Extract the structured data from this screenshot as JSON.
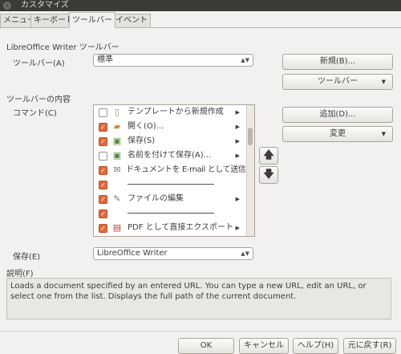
{
  "window": {
    "title": "カスタマイズ",
    "close_glyph": "x"
  },
  "tabs": [
    {
      "label": "メニュー"
    },
    {
      "label": "キーボード"
    },
    {
      "label": "ツールバー"
    },
    {
      "label": "イベント"
    }
  ],
  "toolbar_section": {
    "heading": "LibreOffice Writer ツールバー",
    "toolbar_label": "ツールバー(A)",
    "toolbar_value": "標準",
    "new_button": "新規(B)...",
    "toolbar_menu_button": "ツールバー"
  },
  "content_section": {
    "heading": "ツールバーの内容",
    "command_label": "コマンド(C)",
    "add_button": "追加(D)...",
    "modify_button": "変更",
    "commands": [
      {
        "label": "テンプレートから新規作成",
        "checked": false,
        "icon": "template-icon",
        "glyph": "▯",
        "submenu": true
      },
      {
        "label": "開く(O)...",
        "checked": true,
        "icon": "folder-icon",
        "glyph": "📁",
        "submenu": true
      },
      {
        "label": "保存(S)",
        "checked": true,
        "icon": "save-icon",
        "glyph": "💾",
        "submenu": true
      },
      {
        "label": "名前を付けて保存(A)...",
        "checked": false,
        "icon": "save-as-icon",
        "glyph": "💾",
        "submenu": true
      },
      {
        "label": "ドキュメントを E-mail として送信(E)",
        "checked": true,
        "icon": "email-icon",
        "glyph": "✉",
        "submenu": false
      },
      {
        "label": "",
        "checked": true,
        "separator": true
      },
      {
        "label": "ファイルの編集",
        "checked": true,
        "icon": "edit-file-icon",
        "glyph": "✎",
        "submenu": true
      },
      {
        "label": "",
        "checked": true,
        "separator": true
      },
      {
        "label": "PDF として直接エクスポート",
        "checked": true,
        "icon": "pdf-icon",
        "glyph": "▤",
        "submenu": true
      }
    ],
    "move_up": "🡅",
    "move_down": "🡇"
  },
  "save_in": {
    "label": "保存(E)",
    "value": "LibreOffice Writer"
  },
  "description": {
    "label": "説明(F)",
    "text": "Loads a document specified by an entered URL. You can type a new URL, edit an URL, or select one from the list. Displays the full path of the current document."
  },
  "footer": {
    "ok": "OK",
    "cancel": "キャンセル",
    "help": "ヘルプ(H)",
    "reset": "元に戻す(R)"
  },
  "colors": {
    "accent": "#e06b3a",
    "titlebar": "#3c3b37",
    "background": "#f2f1f0"
  }
}
